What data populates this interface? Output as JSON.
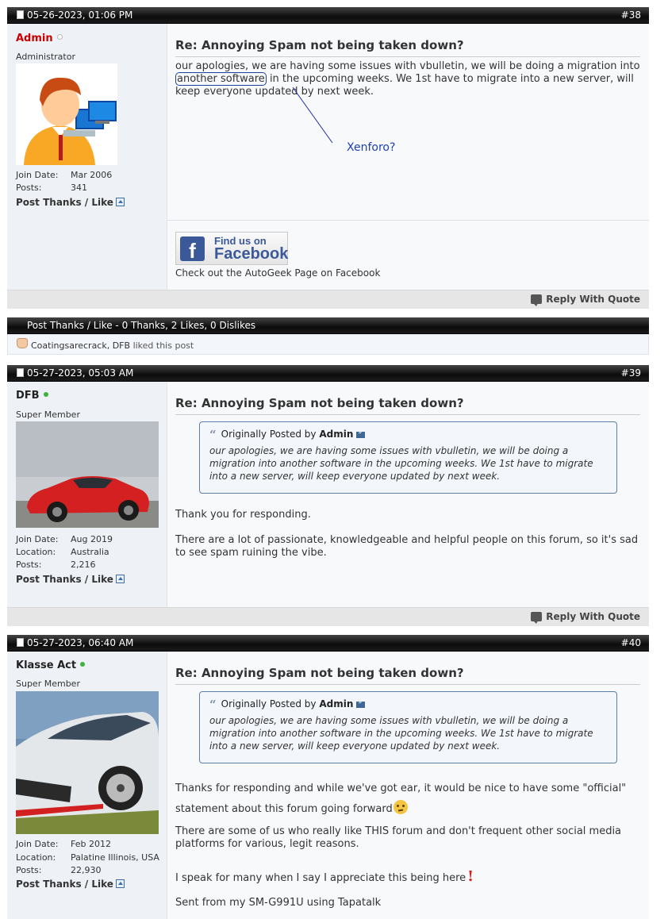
{
  "reply_with_quote": "Reply With Quote",
  "post_thanks_label": "Post Thanks / Like",
  "user_labels": {
    "join_date": "Join Date:",
    "location": "Location:",
    "posts": "Posts:"
  },
  "posts": [
    {
      "date": "05-26-2023, 01:06 PM",
      "number": "#38",
      "username": "Admin",
      "username_color": "#cc0000",
      "online": false,
      "user_title": "Administrator",
      "join_date": "Mar 2006",
      "post_count": "341",
      "title": "Re: Annoying Spam not being taken down?",
      "body_part1": "our apologies, we are having some issues with vbulletin, we will be doing a migration into ",
      "body_highlight": "another software",
      "body_part2": " in the upcoming weeks. We 1st have to migrate into a new server, will keep everyone updated by next week.",
      "annotation": "Xenforo?",
      "facebook": {
        "find_us": "Find us on",
        "brand": "Facebook",
        "caption": "Check out the AutoGeek Page on Facebook"
      }
    },
    {
      "date": "05-27-2023, 05:03 AM",
      "number": "#39",
      "username": "DFB",
      "online": true,
      "user_title": "Super Member",
      "join_date": "Aug 2019",
      "location": "Australia",
      "post_count": "2,216",
      "title": "Re: Annoying Spam not being taken down?",
      "quote_prefix": "Originally Posted by",
      "quote_author": "Admin",
      "quote_text": "our apologies, we are having some issues with vbulletin, we will be doing a migration into another software in the upcoming weeks. We 1st have to migrate into a new server, will keep everyone updated by next week.",
      "paragraphs": [
        "Thank you for responding.",
        "There are a lot of passionate, knowledgeable and helpful people on this forum, so it's sad to see spam ruining the vibe."
      ]
    },
    {
      "date": "05-27-2023, 06:40 AM",
      "number": "#40",
      "username": "Klasse Act",
      "online": true,
      "user_title": "Super Member",
      "join_date": "Feb 2012",
      "location": "Palatine Illinois, USA",
      "post_count": "22,930",
      "title": "Re: Annoying Spam not being taken down?",
      "quote_prefix": "Originally Posted by",
      "quote_author": "Admin",
      "quote_text": "our apologies, we are having some issues with vbulletin, we will be doing a migration into another software in the upcoming weeks. We 1st have to migrate into a new server, will keep everyone updated by next week.",
      "paragraphs": [
        "Thanks for responding and while we've got ear, it would be nice to have some \"official\" statement about this forum going forward",
        "There are some of us who really like THIS forum and don't frequent other social media platforms for various, legit reasons.",
        "I speak for many when I say I appreciate this being here",
        "Sent from my SM-G991U using Tapatalk"
      ]
    }
  ],
  "thanks_bar": {
    "title": "Post Thanks / Like - 0 Thanks, 2 Likes, 0 Dislikes",
    "likers": "Coatingsarecrack, DFB",
    "liked_suffix": "liked this post"
  },
  "colors": {
    "online": "#3cb33c",
    "offline": "#bbbbbb",
    "link": "#1f3f9e",
    "facebook": "#3b5998"
  }
}
